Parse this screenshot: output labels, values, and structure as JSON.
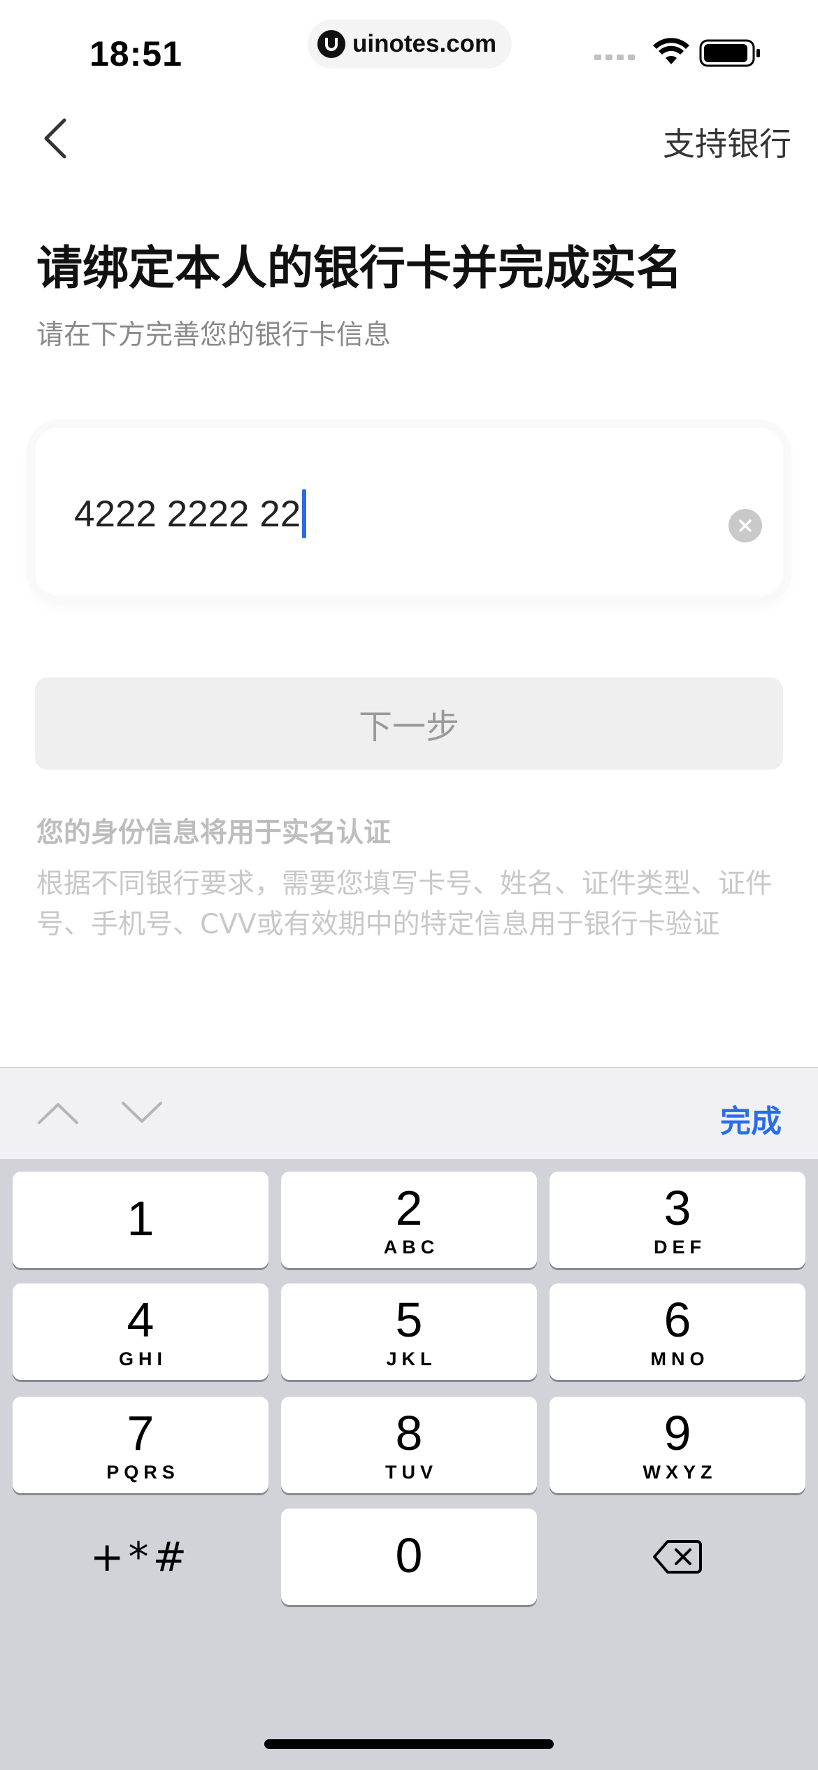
{
  "status_bar": {
    "time": "18:51",
    "watermark": "uinotes.com"
  },
  "nav": {
    "support_bank_label": "支持银行"
  },
  "header": {
    "title": "请绑定本人的银行卡并完成实名",
    "subtitle": "请在下方完善您的银行卡信息"
  },
  "card_input": {
    "value": "4222 2222 22"
  },
  "next_button_label": "下一步",
  "notice": {
    "title": "您的身份信息将用于实名认证",
    "body": "根据不同银行要求，需要您填写卡号、姓名、证件类型、证件号、手机号、CVV或有效期中的特定信息用于银行卡验证"
  },
  "keyboard": {
    "done_label": "完成",
    "symbols_label": "+*#",
    "keys": [
      {
        "digit": "1",
        "letters": ""
      },
      {
        "digit": "2",
        "letters": "ABC"
      },
      {
        "digit": "3",
        "letters": "DEF"
      },
      {
        "digit": "4",
        "letters": "GHI"
      },
      {
        "digit": "5",
        "letters": "JKL"
      },
      {
        "digit": "6",
        "letters": "MNO"
      },
      {
        "digit": "7",
        "letters": "PQRS"
      },
      {
        "digit": "8",
        "letters": "TUV"
      },
      {
        "digit": "9",
        "letters": "WXYZ"
      },
      {
        "digit": "0",
        "letters": ""
      }
    ]
  },
  "colors": {
    "accent": "#2a6be8",
    "title": "#111111",
    "subtitle": "#8a8a8a",
    "disabled_button_bg": "#efefef",
    "keyboard_bg": "#d1d3d9"
  },
  "icons": {
    "back": "chevron-left-icon",
    "clear": "clear-circle-icon",
    "prev_field": "chevron-up-icon",
    "next_field": "chevron-down-icon",
    "delete": "backspace-icon"
  }
}
